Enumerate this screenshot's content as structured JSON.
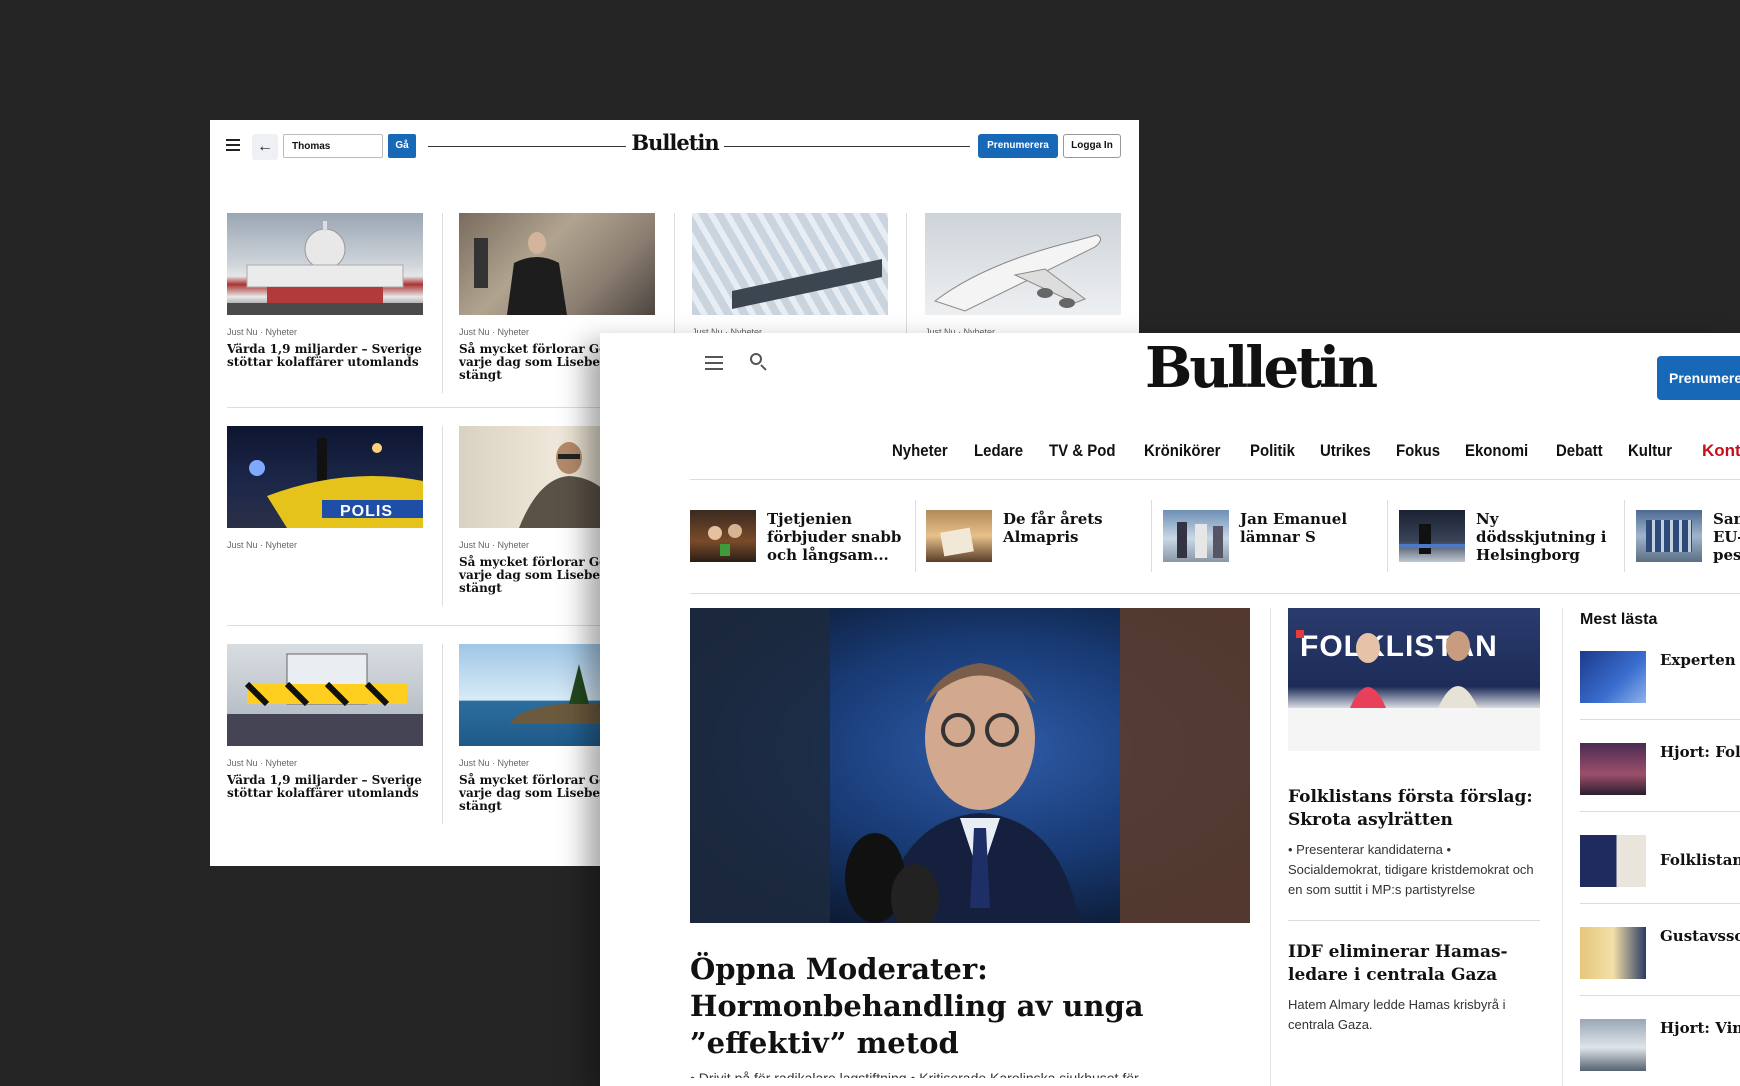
{
  "search_page": {
    "search_value": "Thomas",
    "go_label": "Gå",
    "logo": "Bulletin",
    "subscribe_label": "Prenumerera",
    "login_label": "Logga In",
    "cards": [
      {
        "meta": "Just Nu · Nyheter",
        "title": "Värda 1,9 miljarder – Sverige stöttar kolaffärer utomlands"
      },
      {
        "meta": "Just Nu · Nyheter",
        "title": "Så mycket förlorar Göteborg varje dag som Liseberg är stängt"
      },
      {
        "meta": "Just Nu · Nyheter",
        "title": ""
      },
      {
        "meta": "Just Nu · Nyheter",
        "title": ""
      },
      {
        "meta": "Just Nu · Nyheter",
        "title": ""
      },
      {
        "meta": "Just Nu · Nyheter",
        "title": "Så mycket förlorar Göteborg varje dag som Liseberg är stängt"
      },
      {
        "meta": "Just Nu · Nyheter",
        "title": "Värda 1,9 miljarder – Sverige stöttar kolaffärer utomlands"
      },
      {
        "meta": "Just Nu · Nyheter",
        "title": "Så mycket förlorar Göteborg varje dag som Liseberg är stängt"
      }
    ],
    "police_text": "POLIS"
  },
  "home_page": {
    "logo": "Bulletin",
    "subscribe_label": "Prenumerera",
    "nav": [
      "Nyheter",
      "Ledare",
      "TV & Pod",
      "Krönikörer",
      "Politik",
      "Utrikes",
      "Fokus",
      "Ekonomi",
      "Debatt",
      "Kultur"
    ],
    "nav_contact": "Kontakt",
    "ticker": [
      "Tjetjenien förbjuder snabb och långsam...",
      "De får årets Almapris",
      "Jan Emanuel lämnar S",
      "Ny dödsskjutning i Helsingborg",
      "Sanktioner: EU-pest"
    ],
    "hero": {
      "title": "Öppna Moderater: Hormonbehandling av unga ”effektiv” metod",
      "teaser": "• Drivit på för radikalare lagstiftning • Kritiserade Karolinska sjukhuset för"
    },
    "mid": {
      "banner_text": "FOLKLISTAN",
      "title1": "Folklistans första förslag: Skrota asylrätten",
      "text1": "• Presenterar kandidaterna • Socialdemokrat, tidigare kristdemokrat och en som suttit i MP:s partistyrelse",
      "title2": "IDF eliminerar Hamas-ledare i centrala Gaza",
      "text2": "Hatem Almary ledde Hamas krisbyrå i centrala Gaza."
    },
    "most_read_title": "Mest lästa",
    "most_read": [
      "Experten om Folklistan: skålar Mag",
      "Hjort: Folklistan ut att bli et",
      "Folklistans",
      "Gustavsson granskade röstande –",
      "Hjort: Vind ideologisk kapitalförs"
    ]
  }
}
